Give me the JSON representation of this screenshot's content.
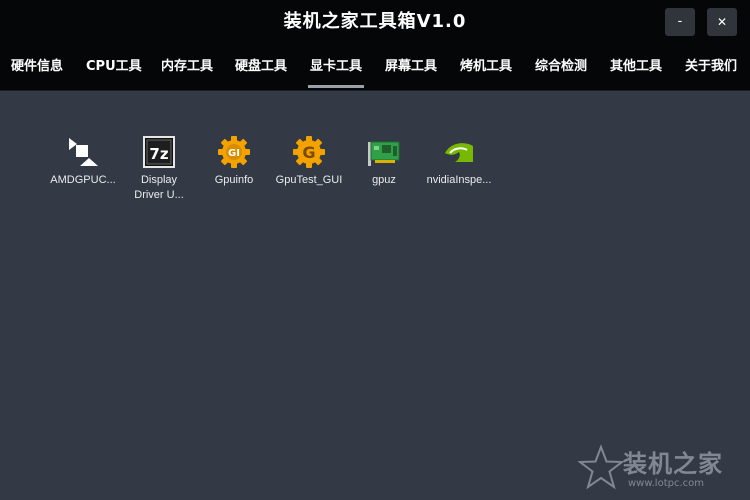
{
  "window": {
    "title": "装机之家工具箱V1.0",
    "minimize_label": "-",
    "close_label": "✕"
  },
  "tabs": [
    {
      "label": "硬件信息",
      "active": false
    },
    {
      "label": "CPU工具",
      "active": false
    },
    {
      "label": "内存工具",
      "active": false
    },
    {
      "label": "硬盘工具",
      "active": false
    },
    {
      "label": "显卡工具",
      "active": true
    },
    {
      "label": "屏幕工具",
      "active": false
    },
    {
      "label": "烤机工具",
      "active": false
    },
    {
      "label": "综合检测",
      "active": false
    },
    {
      "label": "其他工具",
      "active": false
    },
    {
      "label": "关于我们",
      "active": false
    }
  ],
  "apps": [
    {
      "label": "AMDGPUC...",
      "icon": "amd-gpu-clock-icon"
    },
    {
      "label": "Display\nDriver U...",
      "icon": "7z-archive-icon"
    },
    {
      "label": "Gpuinfo",
      "icon": "gpuinfo-gear-icon"
    },
    {
      "label": "GpuTest_GUI",
      "icon": "gputest-gear-icon"
    },
    {
      "label": "gpuz",
      "icon": "graphics-card-icon"
    },
    {
      "label": "nvidiaInspe...",
      "icon": "nvidia-logo-icon"
    }
  ],
  "watermark": {
    "text": "装机之家",
    "url": "www.lotpc.com"
  },
  "colors": {
    "titlebar_bg": "#050607",
    "content_bg": "#343a45",
    "gear_orange": "#f3a200",
    "card_green": "#2f9f48",
    "nvidia_green": "#76b900"
  }
}
